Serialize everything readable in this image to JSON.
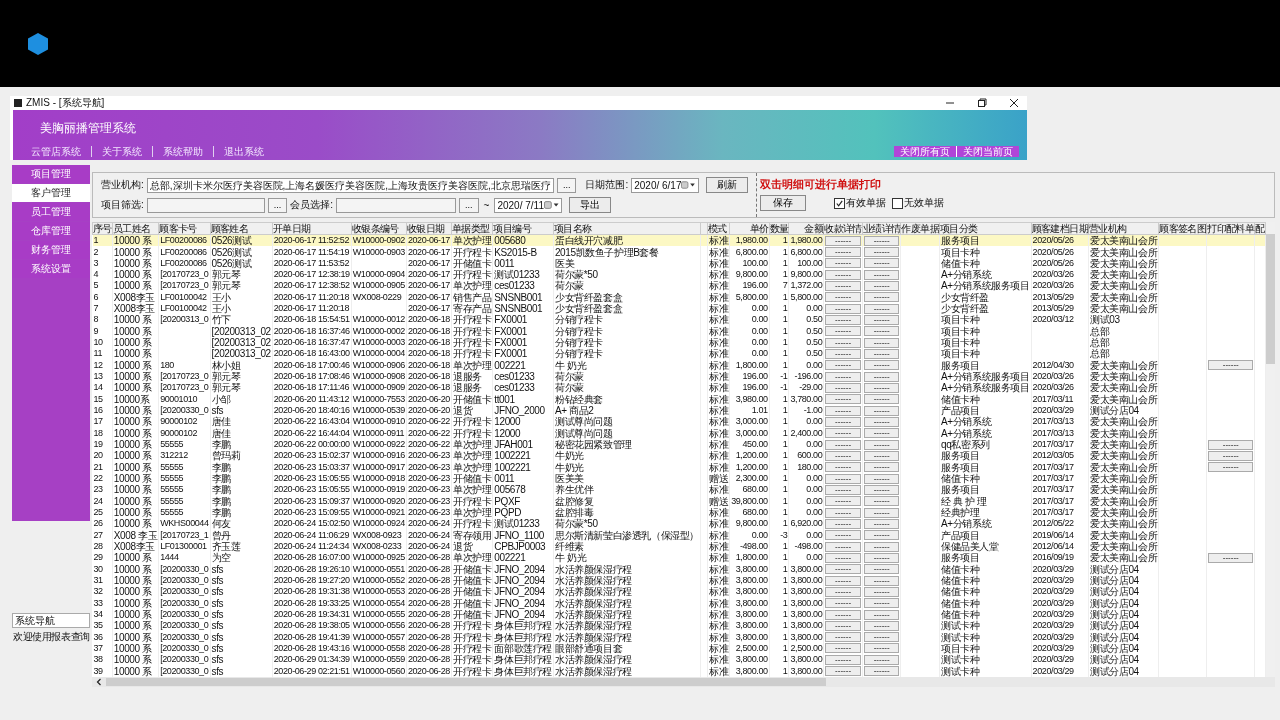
{
  "window": {
    "title": "ZMIS - [系统导航]"
  },
  "banner": {
    "title": "美胸丽播管理系统",
    "menu": [
      "云管店系统",
      "关于系统",
      "系统帮助",
      "退出系统"
    ],
    "page_actions": [
      "关闭所有页",
      "关闭当前页"
    ]
  },
  "sidebar": {
    "items": [
      {
        "label": "项目管理",
        "selected": false
      },
      {
        "label": "客户管理",
        "selected": true
      },
      {
        "label": "员工管理",
        "selected": false
      },
      {
        "label": "仓库管理",
        "selected": false
      },
      {
        "label": "财务管理",
        "selected": false
      },
      {
        "label": "系统设置",
        "selected": false
      }
    ]
  },
  "status_panel": {
    "title": "系统导航",
    "message": "欢迎使用报表查询"
  },
  "filters": {
    "org_label": "营业机构:",
    "org_value": "总部,深圳卡米尔医疗美容医院,上海名媛医疗美容医院,上海玫贵医疗美容医院,北京思瑞医疗",
    "project_label": "项目筛选:",
    "member_label": "会员选择:",
    "browse_button": "...",
    "date_label": "日期范围:",
    "date_from": "2020/ 6/17",
    "date_sep": "~",
    "date_to": "2020/ 7/11",
    "refresh_button": "刷新",
    "export_button": "导出"
  },
  "hint": "双击明细可进行单据打印",
  "save_button": "保存",
  "checkboxes": [
    {
      "label": "有效单据",
      "checked": true
    },
    {
      "label": "无效单据",
      "checked": false
    }
  ],
  "table": {
    "columns": [
      {
        "label": "序号",
        "kind": "latin"
      },
      {
        "label": "员工姓名",
        "kind": "text"
      },
      {
        "label": "顾客卡号",
        "kind": "latin"
      },
      {
        "label": "顾客姓名",
        "kind": "text"
      },
      {
        "label": "开单日期",
        "kind": "latin"
      },
      {
        "label": "收银条编号",
        "kind": "latin"
      },
      {
        "label": "收银日期",
        "kind": "latin"
      },
      {
        "label": "单据类型",
        "kind": "text"
      },
      {
        "label": "项目编号",
        "kind": "text"
      },
      {
        "label": "项目名称",
        "kind": "text"
      },
      {
        "label": "模式",
        "kind": "center"
      },
      {
        "label": "单价",
        "kind": "num"
      },
      {
        "label": "数量",
        "kind": "num"
      },
      {
        "label": "金额",
        "kind": "num"
      },
      {
        "label": "收款详情",
        "kind": "button"
      },
      {
        "label": "业绩详情",
        "kind": "button"
      },
      {
        "label": "作废单据",
        "kind": "text"
      },
      {
        "label": "项目分类",
        "kind": "text"
      },
      {
        "label": "顾客建档日期",
        "kind": "latin"
      },
      {
        "label": "营业机构",
        "kind": "text"
      },
      {
        "label": "顾客签名图",
        "kind": "text"
      },
      {
        "label": "打印配料单",
        "kind": "button"
      },
      {
        "label": "配",
        "kind": "text"
      }
    ],
    "rows": [
      {
        "selected": true,
        "cells": [
          "1",
          "10000 系",
          "LF00200086",
          "0526测试",
          "2020-06-17 11:52:52",
          "W10000-0902",
          "2020-06-17",
          "单次护理",
          "005680",
          "蛋白线开穴减肥",
          "标准",
          "1,980.00",
          "1",
          "1,980.00",
          "------",
          "------",
          null,
          "服务项目",
          "2020/05/26",
          "爱太美南山会所",
          null,
          null,
          null
        ]
      },
      {
        "selected": false,
        "cells": [
          "2",
          "10000 系",
          "LF00200086",
          "0526测试",
          "2020-06-17 11:54:19",
          "W10000-0903",
          "2020-06-17",
          "开疗程卡",
          "KS2015-B",
          "2015凯数鱼子护理B套餐",
          "标准",
          "6,800.00",
          "1",
          "6,800.00",
          "------",
          "------",
          null,
          "项目卡种",
          "2020/05/26",
          "爱太美南山会所",
          null,
          null,
          null
        ]
      },
      {
        "selected": false,
        "cells": [
          "3",
          "10000 系",
          "LF00200086",
          "0526测试",
          "2020-06-17 11:53:52",
          null,
          "2020-06-17",
          "开储值卡",
          "0011",
          "医美",
          "标准",
          "100.00",
          "1",
          "100.00",
          "------",
          "------",
          null,
          "储值卡种",
          "2020/05/26",
          "爱太美南山会所",
          null,
          null,
          null
        ]
      },
      {
        "selected": false,
        "cells": [
          "4",
          "10000 系",
          "[20170723_0",
          "郭元琴",
          "2020-06-17 12:38:19",
          "W10000-0904",
          "2020-06-17",
          "开疗程卡",
          "测试01233",
          "荷尔蒙*50",
          "标准",
          "9,800.00",
          "1",
          "9,800.00",
          "------",
          "------",
          null,
          "A+分销系统",
          "2020/03/26",
          "爱太美南山会所",
          null,
          null,
          null
        ]
      },
      {
        "selected": false,
        "cells": [
          "5",
          "10000 系",
          "[20170723_0",
          "郭元琴",
          "2020-06-17 12:38:52",
          "W10000-0905",
          "2020-06-17",
          "单次护理",
          "ces01233",
          "荷尔蒙",
          "标准",
          "196.00",
          "7",
          "1,372.00",
          "------",
          "------",
          null,
          "A+分销系统服务项目",
          "2020/03/26",
          "爱太美南山会所",
          null,
          null,
          null
        ]
      },
      {
        "selected": false,
        "cells": [
          "6",
          "X008李玉",
          "LF00100042",
          "王小",
          "2020-06-17 11:20:18",
          "WX008-0229",
          "2020-06-17",
          "销售产品",
          "SNSNB001",
          "少女背纤盈套盒",
          "标准",
          "5,800.00",
          "1",
          "5,800.00",
          "------",
          "------",
          null,
          "少女背纤盈",
          "2013/05/29",
          "爱太美南山会所",
          null,
          null,
          null
        ]
      },
      {
        "selected": false,
        "cells": [
          "7",
          "X008李玉",
          "LF00100042",
          "王小",
          "2020-06-17 11:20:18",
          null,
          "2020-06-17",
          "寄存产品",
          "SNSNB001",
          "少女背纤盈套盒",
          "标准",
          "0.00",
          "1",
          "0.00",
          "------",
          "------",
          null,
          "少女背纤盈",
          "2013/05/29",
          "爱太美南山会所",
          null,
          null,
          null
        ]
      },
      {
        "selected": false,
        "cells": [
          "8",
          "10000 系",
          "[20200313_0",
          "竹下",
          "2020-06-18 15:54:51",
          "W10000-0012",
          "2020-06-18",
          "开疗程卡",
          "FX0001",
          "分销疗程卡",
          "标准",
          "0.00",
          "1",
          "0.50",
          "------",
          "------",
          null,
          "项目卡种",
          "2020/03/12",
          "测试03",
          null,
          null,
          null
        ]
      },
      {
        "selected": false,
        "cells": [
          "9",
          "10000 系",
          null,
          "[20200313_02",
          "2020-06-18 16:37:46",
          "W10000-0002",
          "2020-06-18",
          "开疗程卡",
          "FX0001",
          "分销疗程卡",
          "标准",
          "0.00",
          "1",
          "0.50",
          "------",
          "------",
          null,
          "项目卡种",
          null,
          "总部",
          null,
          null,
          null
        ]
      },
      {
        "selected": false,
        "cells": [
          "10",
          "10000 系",
          null,
          "[20200313_02",
          "2020-06-18 16:37:47",
          "W10000-0003",
          "2020-06-18",
          "开疗程卡",
          "FX0001",
          "分销疗程卡",
          "标准",
          "0.00",
          "1",
          "0.50",
          "------",
          "------",
          null,
          "项目卡种",
          null,
          "总部",
          null,
          null,
          null
        ]
      },
      {
        "selected": false,
        "cells": [
          "11",
          "10000 系",
          null,
          "[20200313_02",
          "2020-06-18 16:43:00",
          "W10000-0004",
          "2020-06-18",
          "开疗程卡",
          "FX0001",
          "分销疗程卡",
          "标准",
          "0.00",
          "1",
          "0.50",
          "------",
          "------",
          null,
          "项目卡种",
          null,
          "总部",
          null,
          null,
          null
        ]
      },
      {
        "selected": false,
        "cells": [
          "12",
          "10000 系",
          "180",
          "林小姐",
          "2020-06-18 17:00:46",
          "W10000-0906",
          "2020-06-18",
          "单次护理",
          "002221",
          "牛 奶光",
          "标准",
          "1,800.00",
          "1",
          "0.00",
          "------",
          "------",
          null,
          "服务项目",
          "2012/04/30",
          "爱太美南山会所",
          null,
          "------",
          null
        ]
      },
      {
        "selected": false,
        "cells": [
          "13",
          "10000 系",
          "[20170723_0",
          "郭元琴",
          "2020-06-18 17:08:46",
          "W10000-0908",
          "2020-06-18",
          "退服务",
          "ces01233",
          "荷尔蒙",
          "标准",
          "196.00",
          "-1",
          "-196.00",
          "------",
          "------",
          null,
          "A+分销系统服务项目",
          "2020/03/26",
          "爱太美南山会所",
          null,
          null,
          null
        ]
      },
      {
        "selected": false,
        "cells": [
          "14",
          "10000 系",
          "[20170723_0",
          "郭元琴",
          "2020-06-18 17:11:46",
          "W10000-0909",
          "2020-06-18",
          "退服务",
          "ces01233",
          "荷尔蒙",
          "标准",
          "196.00",
          "-1",
          "-29.00",
          "------",
          "------",
          null,
          "A+分销系统服务项目",
          "2020/03/26",
          "爱太美南山会所",
          null,
          null,
          null
        ]
      },
      {
        "selected": false,
        "cells": [
          "15",
          "10000系",
          "90001010",
          "小邹",
          "2020-06-20 11:43:12",
          "W10000-7553",
          "2020-06-20",
          "开储值卡",
          "tt001",
          "粉钻经典套",
          "标准",
          "3,980.00",
          "1",
          "3,780.00",
          "------",
          "------",
          null,
          "储值卡种",
          "2017/03/11",
          "爱太美南山会所",
          null,
          null,
          null
        ]
      },
      {
        "selected": false,
        "cells": [
          "16",
          "10000 系",
          "[20200330_0",
          "sfs",
          "2020-06-20 18:40:16",
          "W10000-0539",
          "2020-06-20",
          "退货",
          "JFNO_2000",
          "A+ 商品2",
          "标准",
          "1.01",
          "1",
          "-1.00",
          "------",
          "------",
          null,
          "产品项目",
          "2020/03/29",
          "测试分店04",
          null,
          null,
          null
        ]
      },
      {
        "selected": false,
        "cells": [
          "17",
          "10000 系",
          "90000102",
          "唐佳",
          "2020-06-22 16:43:04",
          "W10000-0910",
          "2020-06-22",
          "开疗程卡",
          "12000",
          "测试尊尚问题",
          "标准",
          "3,000.00",
          "1",
          "0.00",
          "------",
          "------",
          null,
          "A+分销系统",
          "2017/03/13",
          "爱太美南山会所",
          null,
          null,
          null
        ]
      },
      {
        "selected": false,
        "cells": [
          "18",
          "10000 系",
          "90000102",
          "唐佳",
          "2020-06-22 16:44:04",
          "W10000-0911",
          "2020-06-22",
          "开疗程卡",
          "12000",
          "测试尊尚问题",
          "标准",
          "3,000.00",
          "1",
          "2,400.00",
          "------",
          "------",
          null,
          "A+分销系统",
          "2017/03/13",
          "爱太美南山会所",
          null,
          null,
          null
        ]
      },
      {
        "selected": false,
        "cells": [
          "19",
          "10000 系",
          "55555",
          "李鹏",
          "2020-06-22 00:00:00",
          "W10000-0922",
          "2020-06-22",
          "单次护理",
          "JFAH001",
          "秘密花园紧致管理",
          "标准",
          "450.00",
          "1",
          "0.00",
          "------",
          "------",
          null,
          "qq私密系列",
          "2017/03/17",
          "爱太美南山会所",
          null,
          "------",
          null
        ]
      },
      {
        "selected": false,
        "cells": [
          "20",
          "10000 系",
          "312212",
          "曾玛莉",
          "2020-06-23 15:02:37",
          "W10000-0916",
          "2020-06-23",
          "单次护理",
          "1002221",
          "牛奶光",
          "标准",
          "1,200.00",
          "1",
          "600.00",
          "------",
          "------",
          null,
          "服务项目",
          "2012/03/05",
          "爱太美南山会所",
          null,
          "------",
          null
        ]
      },
      {
        "selected": false,
        "cells": [
          "21",
          "10000 系",
          "55555",
          "李鹏",
          "2020-06-23 15:03:37",
          "W10000-0917",
          "2020-06-23",
          "单次护理",
          "1002221",
          "牛奶光",
          "标准",
          "1,200.00",
          "1",
          "180.00",
          "------",
          "------",
          null,
          "服务项目",
          "2017/03/17",
          "爱太美南山会所",
          null,
          "------",
          null
        ]
      },
      {
        "selected": false,
        "cells": [
          "22",
          "10000 系",
          "55555",
          "李鹏",
          "2020-06-23 15:05:55",
          "W10000-0918",
          "2020-06-23",
          "开储值卡",
          "0011",
          "医美美",
          "赠送",
          "2,300.00",
          "1",
          "0.00",
          "------",
          "------",
          null,
          "储值卡种",
          "2017/03/17",
          "爱太美南山会所",
          null,
          null,
          null
        ]
      },
      {
        "selected": false,
        "cells": [
          "23",
          "10000 系",
          "55555",
          "李鹏",
          "2020-06-23 15:05:55",
          "W10000-0919",
          "2020-06-23",
          "单次护理",
          "005678",
          "养生优伴",
          "标准",
          "680.00",
          "1",
          "0.00",
          "------",
          "------",
          null,
          "服务项目",
          "2017/03/17",
          "爱太美南山会所",
          null,
          null,
          null
        ]
      },
      {
        "selected": false,
        "cells": [
          "24",
          "10000 系",
          "55555",
          "李鹏",
          "2020-06-23 15:09:37",
          "W10000-0920",
          "2020-06-23",
          "开疗程卡",
          "PQXF",
          "盆腔修复",
          "赠送",
          "39,800.00",
          "1",
          "0.00",
          "------",
          "------",
          null,
          "经 典 护 理",
          "2017/03/17",
          "爱太美南山会所",
          null,
          null,
          null
        ]
      },
      {
        "selected": false,
        "cells": [
          "25",
          "10000 系",
          "55555",
          "李鹏",
          "2020-06-23 15:09:55",
          "W10000-0921",
          "2020-06-23",
          "单次护理",
          "PQPD",
          "盆腔排毒",
          "标准",
          "680.00",
          "1",
          "0.00",
          "------",
          "------",
          null,
          "经典护理",
          "2017/03/17",
          "爱太美南山会所",
          null,
          null,
          null
        ]
      },
      {
        "selected": false,
        "cells": [
          "26",
          "10000 系",
          "WKHS00044",
          "何友",
          "2020-06-24 15:02:50",
          "W10000-0924",
          "2020-06-24",
          "开疗程卡",
          "测试01233",
          "荷尔蒙*50",
          "标准",
          "9,800.00",
          "1",
          "6,920.00",
          "------",
          "------",
          null,
          "A+分销系统",
          "2012/05/22",
          "爱太美南山会所",
          null,
          null,
          null
        ]
      },
      {
        "selected": false,
        "cells": [
          "27",
          "X008 李玉",
          "[20170723_1",
          "曾丹",
          "2020-06-24 11:06:29",
          "WX008-0923",
          "2020-06-24",
          "寄存领用",
          "JFNO_1100",
          "思尔斯清新莹白渗透乳（保湿型）",
          "标准",
          "0.00",
          "-3",
          "0.00",
          "------",
          "------",
          null,
          "产品项目",
          "2019/06/14",
          "爱太美南山会所",
          null,
          null,
          null
        ]
      },
      {
        "selected": false,
        "cells": [
          "28",
          "X008李玉",
          "LF01300001",
          "齐玉莲",
          "2020-06-24 11:24:34",
          "WX008-0233",
          "2020-06-24",
          "退货",
          "CPBJP0003",
          "纤维素",
          "标准",
          "-498.00",
          "1",
          "-498.00",
          "------",
          "------",
          null,
          "保健品美人堂",
          "2012/06/14",
          "爱太美南山会所",
          null,
          null,
          null
        ]
      },
      {
        "selected": false,
        "cells": [
          "29",
          "10000 系",
          "1444",
          "为空",
          "2020-06-28 16:07:00",
          "W10000-0925",
          "2020-06-28",
          "单次护理",
          "002221",
          "牛 奶光",
          "标准",
          "1,800.00",
          "1",
          "0.00",
          "------",
          "------",
          null,
          "服务项目",
          "2016/09/19",
          "爱太美南山会所",
          null,
          "------",
          null
        ]
      },
      {
        "selected": false,
        "cells": [
          "30",
          "10000 系",
          "[20200330_0",
          "sfs",
          "2020-06-28 19:26:10",
          "W10000-0551",
          "2020-06-28",
          "开储值卡",
          "JFNO_2094",
          "水活养颜保湿疗程",
          "标准",
          "3,800.00",
          "1",
          "3,800.00",
          "------",
          "------",
          null,
          "储值卡种",
          "2020/03/29",
          "测试分店04",
          null,
          null,
          null
        ]
      },
      {
        "selected": false,
        "cells": [
          "31",
          "10000 系",
          "[20200330_0",
          "sfs",
          "2020-06-28 19:27:20",
          "W10000-0552",
          "2020-06-28",
          "开储值卡",
          "JFNO_2094",
          "水活养颜保湿疗程",
          "标准",
          "3,800.00",
          "1",
          "3,800.00",
          "------",
          "------",
          null,
          "储值卡种",
          "2020/03/29",
          "测试分店04",
          null,
          null,
          null
        ]
      },
      {
        "selected": false,
        "cells": [
          "32",
          "10000 系",
          "[20200330_0",
          "sfs",
          "2020-06-28 19:31:38",
          "W10000-0553",
          "2020-06-28",
          "开储值卡",
          "JFNO_2094",
          "水活养颜保湿疗程",
          "标准",
          "3,800.00",
          "1",
          "3,800.00",
          "------",
          "------",
          null,
          "储值卡种",
          "2020/03/29",
          "测试分店04",
          null,
          null,
          null
        ]
      },
      {
        "selected": false,
        "cells": [
          "33",
          "10000 系",
          "[20200330_0",
          "sfs",
          "2020-06-28 19:33:25",
          "W10000-0554",
          "2020-06-28",
          "开储值卡",
          "JFNO_2094",
          "水活养颜保湿疗程",
          "标准",
          "3,800.00",
          "1",
          "3,800.00",
          "------",
          "------",
          null,
          "储值卡种",
          "2020/03/29",
          "测试分店04",
          null,
          null,
          null
        ]
      },
      {
        "selected": false,
        "cells": [
          "34",
          "10000 系",
          "[20200330_0",
          "sfs",
          "2020-06-28 19:34:31",
          "W10000-0555",
          "2020-06-28",
          "开储值卡",
          "JFNO_2094",
          "水活养颜保湿疗程",
          "标准",
          "3,800.00",
          "1",
          "3,800.00",
          "------",
          "------",
          null,
          "储值卡种",
          "2020/03/29",
          "测试分店04",
          null,
          null,
          null
        ]
      },
      {
        "selected": false,
        "cells": [
          "35",
          "10000 系",
          "[20200330_0",
          "sfs",
          "2020-06-28 19:38:05",
          "W10000-0556",
          "2020-06-28",
          "开疗程卡",
          "身体巨邦疗程",
          "水活养颜保湿疗程",
          "标准",
          "3,800.00",
          "1",
          "3,800.00",
          "------",
          "------",
          null,
          "测试卡种",
          "2020/03/29",
          "测试分店04",
          null,
          null,
          null
        ]
      },
      {
        "selected": false,
        "cells": [
          "36",
          "10000 系",
          "[20200330_0",
          "sfs",
          "2020-06-28 19:41:39",
          "W10000-0557",
          "2020-06-28",
          "开疗程卡",
          "身体巨邦疗程",
          "水活养颜保湿疗程",
          "标准",
          "3,800.00",
          "1",
          "3,800.00",
          "------",
          "------",
          null,
          "测试卡种",
          "2020/03/29",
          "测试分店04",
          null,
          null,
          null
        ]
      },
      {
        "selected": false,
        "cells": [
          "37",
          "10000 系",
          "[20200330_0",
          "sfs",
          "2020-06-28 19:43:16",
          "W10000-0558",
          "2020-06-28",
          "开疗程卡",
          "面部歌莲疗程",
          "眼部舒通项目套",
          "标准",
          "2,500.00",
          "1",
          "2,500.00",
          "------",
          "------",
          null,
          "项目卡种",
          "2020/03/29",
          "测试分店04",
          null,
          null,
          null
        ]
      },
      {
        "selected": false,
        "cells": [
          "38",
          "10000 系",
          "[20200330_0",
          "sfs",
          "2020-06-29 01:34:39",
          "W10000-0559",
          "2020-06-28",
          "开疗程卡",
          "身体巨邦疗程",
          "水活养颜保湿疗程",
          "标准",
          "3,800.00",
          "1",
          "3,800.00",
          "------",
          "------",
          null,
          "测试卡种",
          "2020/03/29",
          "测试分店04",
          null,
          null,
          null
        ]
      },
      {
        "selected": false,
        "cells": [
          "39",
          "10000 系",
          "[20200330_0",
          "sfs",
          "2020-06-29 02:21:51",
          "W10000-0560",
          "2020-06-28",
          "开疗程卡",
          "身体巨邦疗程",
          "水活养颜保湿疗程",
          "标准",
          "3,800.00",
          "1",
          "3,800.00",
          "------",
          "------",
          null,
          "测试卡种",
          "2020/03/29",
          "测试分店04",
          null,
          null,
          null
        ]
      }
    ]
  }
}
